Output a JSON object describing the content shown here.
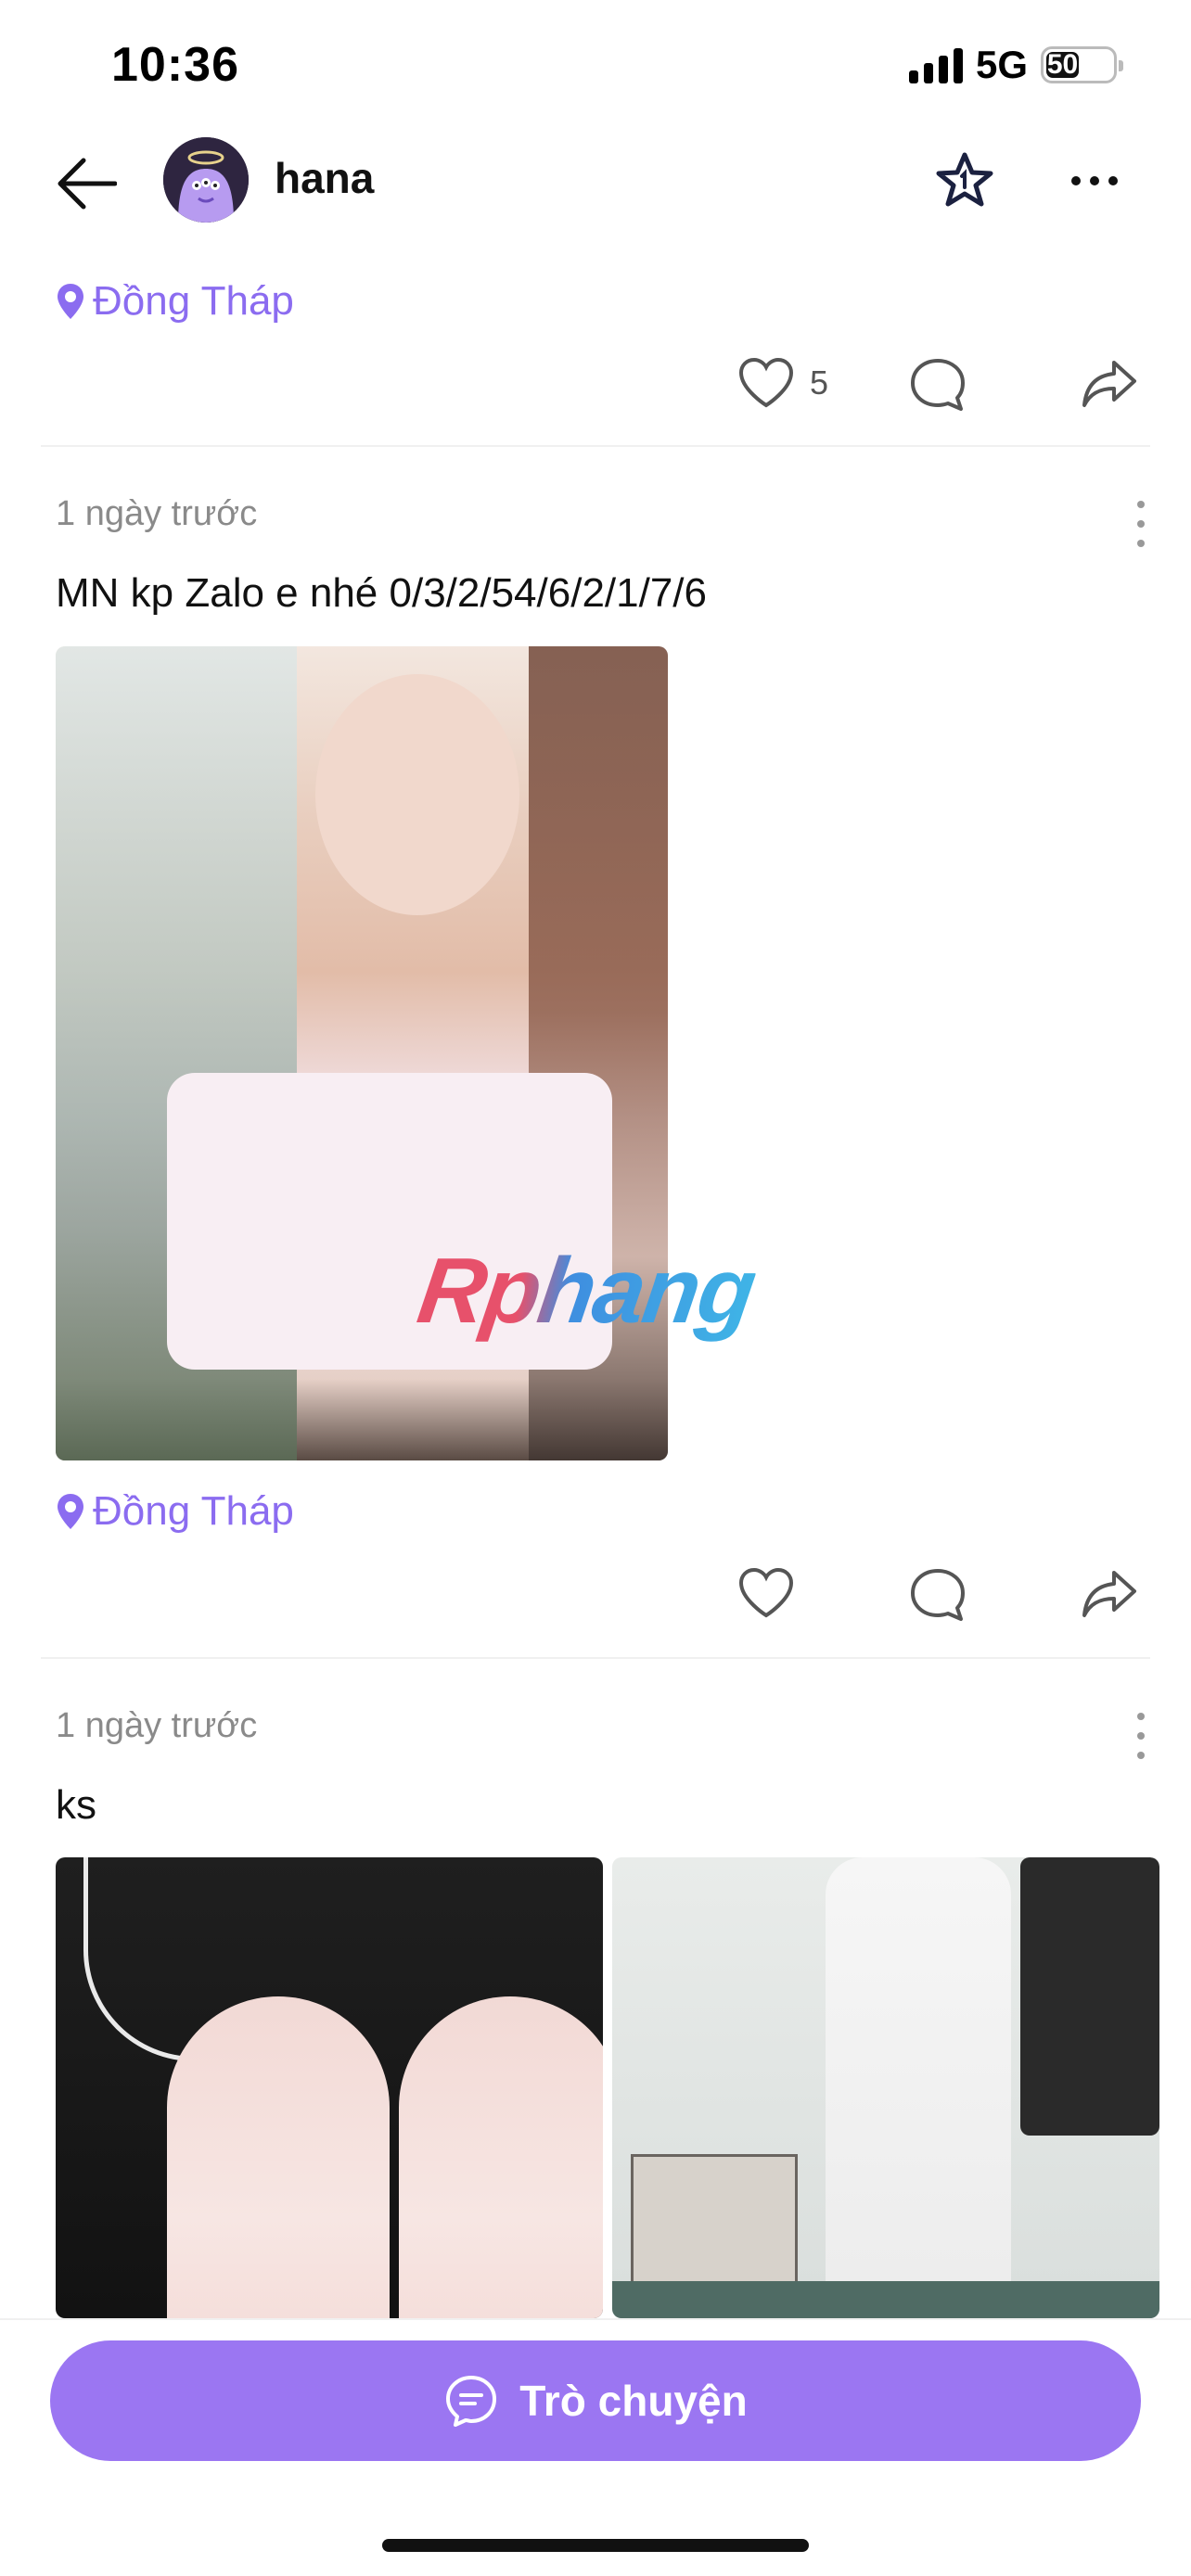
{
  "status_bar": {
    "time": "10:36",
    "network": "5G",
    "battery": "50"
  },
  "header": {
    "username": "hana"
  },
  "posts": [
    {
      "location": "Đồng Tháp",
      "likes": "5"
    },
    {
      "time": "1 ngày trước",
      "text": "MN kp Zalo e nhé 0/3/2/54/6/2/1/7/6",
      "watermark": "Rphang",
      "location": "Đồng Tháp"
    },
    {
      "time": "1 ngày trước",
      "text": "ks"
    }
  ],
  "bottom": {
    "chat_label": "Trò chuyện"
  },
  "colors": {
    "accent": "#9b76f2",
    "location": "#8b6cf0"
  }
}
